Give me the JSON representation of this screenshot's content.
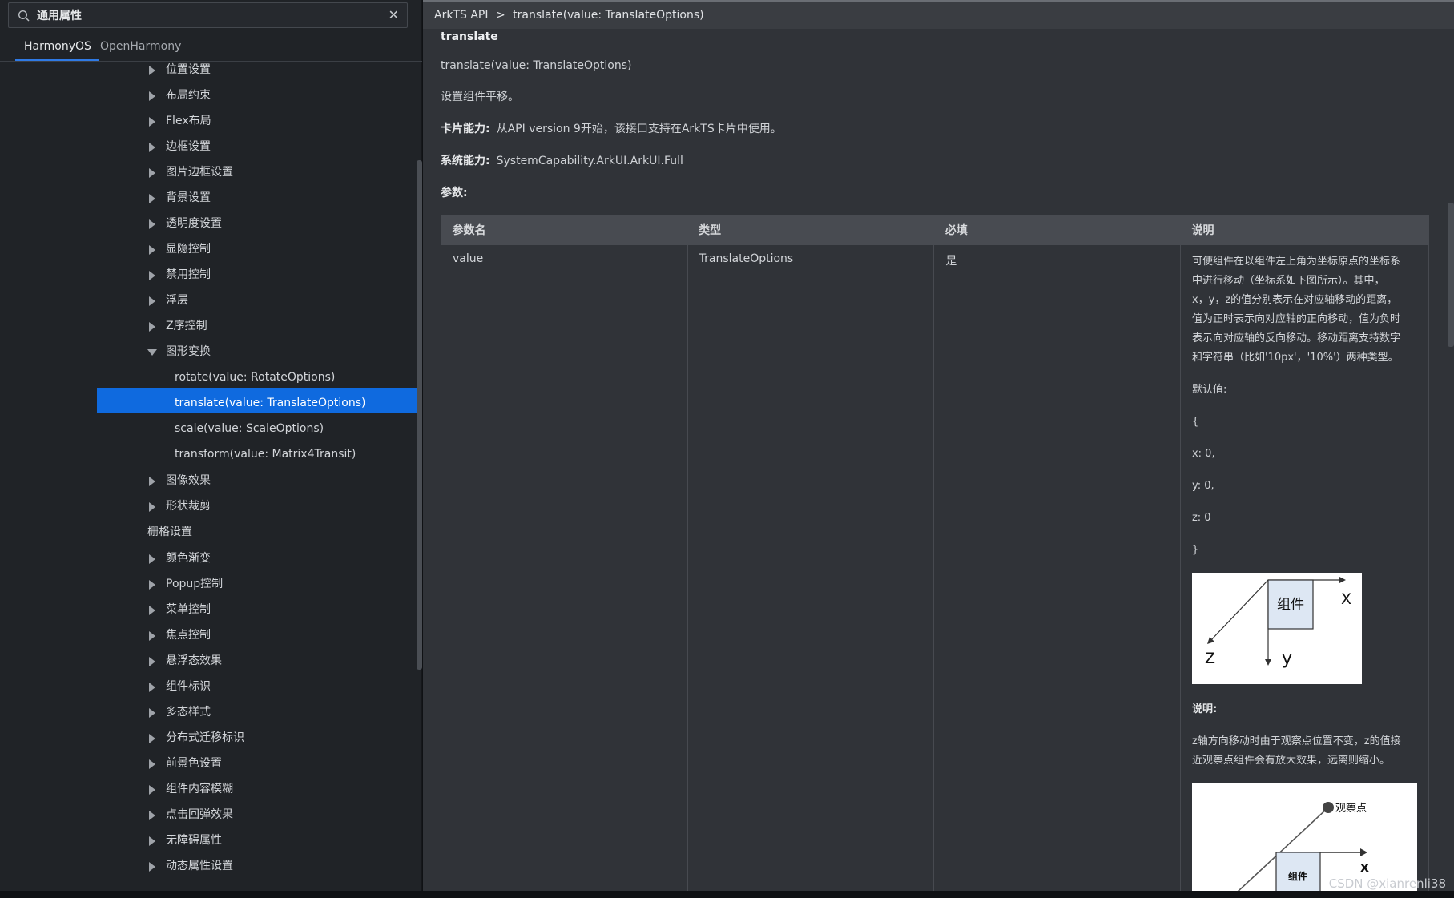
{
  "search": {
    "value": "通用属性"
  },
  "tabs": [
    {
      "label": "HarmonyOS"
    },
    {
      "label": "OpenHarmony"
    }
  ],
  "tree": [
    {
      "label": "位置设置"
    },
    {
      "label": "布局约束"
    },
    {
      "label": "Flex布局"
    },
    {
      "label": "边框设置"
    },
    {
      "label": "图片边框设置"
    },
    {
      "label": "背景设置"
    },
    {
      "label": "透明度设置"
    },
    {
      "label": "显隐控制"
    },
    {
      "label": "禁用控制"
    },
    {
      "label": "浮层"
    },
    {
      "label": "Z序控制"
    },
    {
      "label": "图形变换"
    },
    {
      "label": "rotate(value: RotateOptions)"
    },
    {
      "label": "translate(value: TranslateOptions)"
    },
    {
      "label": "scale(value: ScaleOptions)"
    },
    {
      "label": "transform(value: Matrix4Transit)"
    },
    {
      "label": "图像效果"
    },
    {
      "label": "形状裁剪"
    },
    {
      "label": "栅格设置"
    },
    {
      "label": "颜色渐变"
    },
    {
      "label": "Popup控制"
    },
    {
      "label": "菜单控制"
    },
    {
      "label": "焦点控制"
    },
    {
      "label": "悬浮态效果"
    },
    {
      "label": "组件标识"
    },
    {
      "label": "多态样式"
    },
    {
      "label": "分布式迁移标识"
    },
    {
      "label": "前景色设置"
    },
    {
      "label": "组件内容模糊"
    },
    {
      "label": "点击回弹效果"
    },
    {
      "label": "无障碍属性"
    },
    {
      "label": "动态属性设置"
    }
  ],
  "breadcrumb": {
    "root": "ArkTS API",
    "sep": ">",
    "current": "translate(value: TranslateOptions)"
  },
  "content": {
    "title": "translate",
    "signature": "translate(value: TranslateOptions)",
    "summary": "设置组件平移。",
    "card_label": "卡片能力:",
    "card_value": "从API version 9开始，该接口支持在ArkTS卡片中使用。",
    "syscap_label": "系统能力:",
    "syscap_value": "SystemCapability.ArkUI.ArkUI.Full",
    "params_label": "参数:"
  },
  "table": {
    "headers": [
      "参数名",
      "类型",
      "必填",
      "说明"
    ],
    "row": {
      "name": "value",
      "type": "TranslateOptions",
      "required": "是",
      "desc_lines": [
        "可使组件在以组件左上角为坐标原点的坐标系",
        "中进行移动（坐标系如下图所示）。其中，",
        "x，y，z的值分别表示在对应轴移动的距离，",
        "值为正时表示向对应轴的正向移动，值为负时",
        "表示向对应轴的反向移动。移动距离支持数字",
        "和字符串（比如'10px'，'10%'）两种类型。"
      ],
      "default_label": "默认值:",
      "default_lines": [
        "{",
        "x: 0,",
        "y: 0,",
        "z: 0",
        "}"
      ],
      "diagram1": {
        "component": "组件",
        "x": "X",
        "y": "y",
        "z": "Z"
      },
      "note_label": "说明:",
      "note_lines": [
        "z轴方向移动时由于观察点位置不变，z的值接",
        "近观察点组件会有放大效果，远离则缩小。"
      ],
      "diagram2": {
        "observer": "观察点",
        "x": "x",
        "component": "组件"
      }
    }
  },
  "watermark": "CSDN @xianrenli38"
}
